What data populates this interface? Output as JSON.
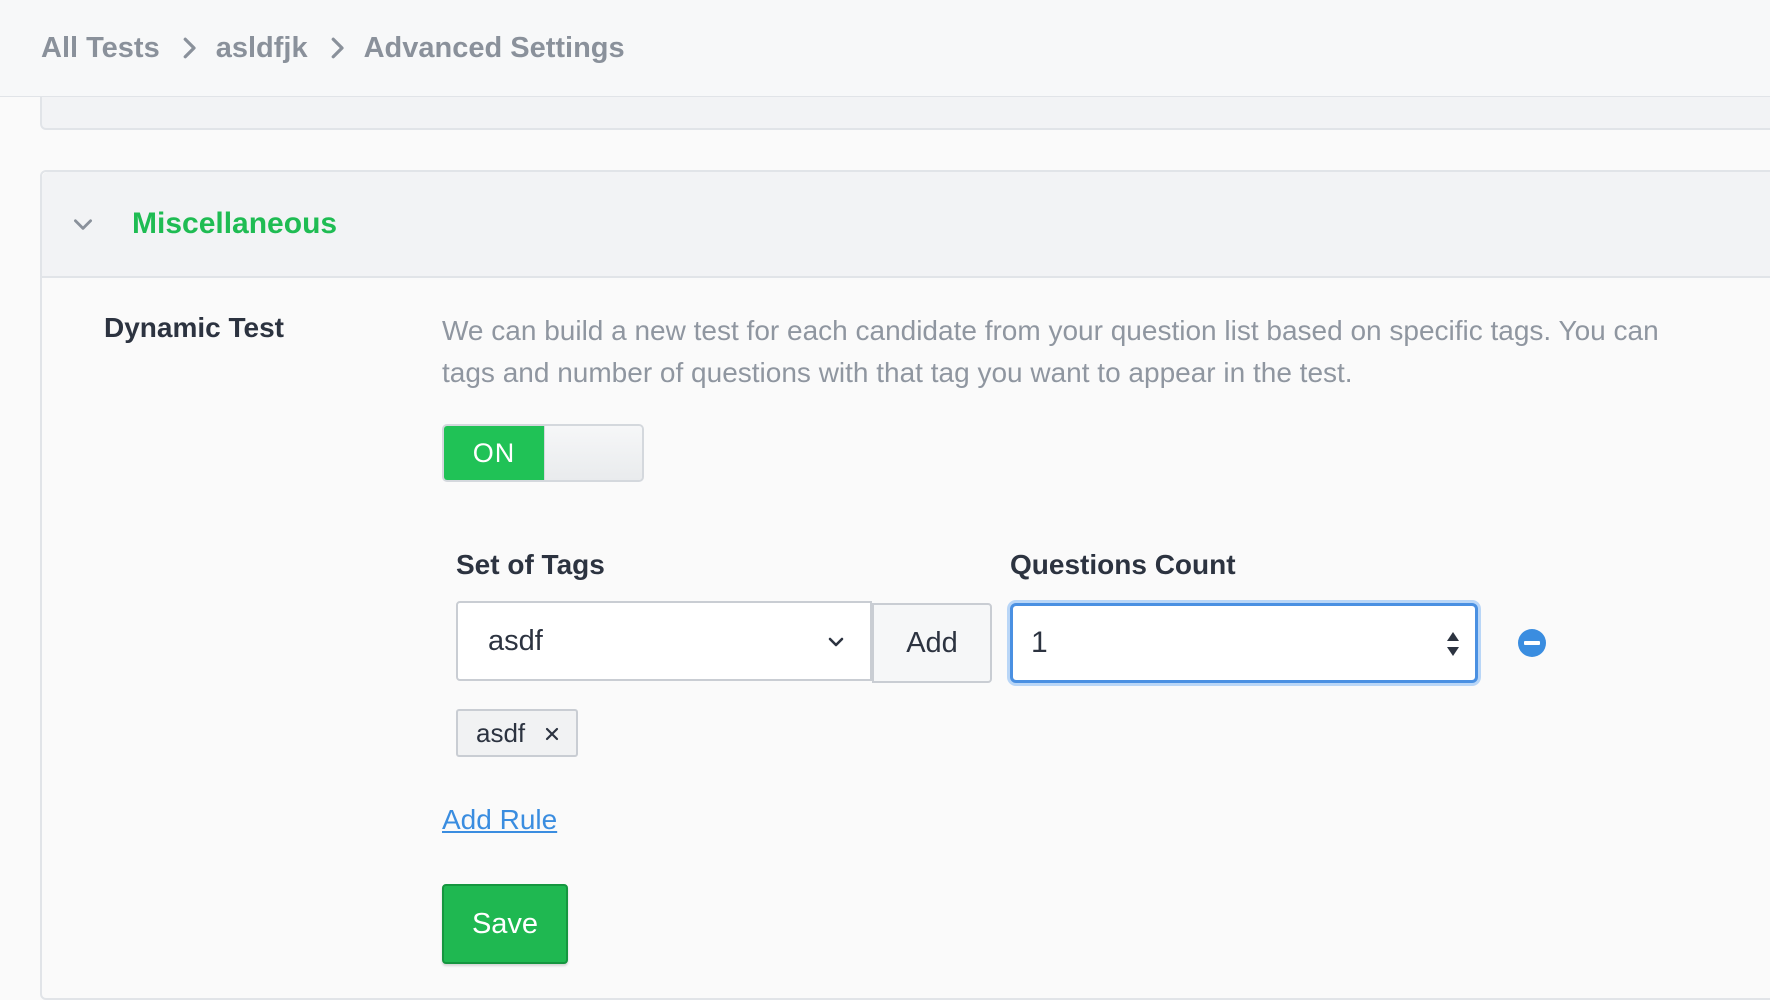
{
  "breadcrumb": {
    "items": [
      "All Tests",
      "asldfjk",
      "Advanced Settings"
    ]
  },
  "section": {
    "title": "Miscellaneous"
  },
  "dynamic_test": {
    "label": "Dynamic Test",
    "description_line1": "We can build a new test for each candidate from your question list based on specific tags. You can",
    "description_line2": "tags and number of questions with that tag you want to appear in the test.",
    "toggle_label": "ON"
  },
  "rule": {
    "tags_label": "Set of Tags",
    "tags_select_value": "asdf",
    "add_button_label": "Add",
    "count_label": "Questions Count",
    "count_value": "1",
    "selected_tags": [
      "asdf"
    ]
  },
  "actions": {
    "add_rule_label": "Add Rule",
    "save_label": "Save"
  },
  "colors": {
    "accent_green": "#1fbc53",
    "link_blue": "#3a8de0",
    "focus_blue": "#4a90e2"
  }
}
